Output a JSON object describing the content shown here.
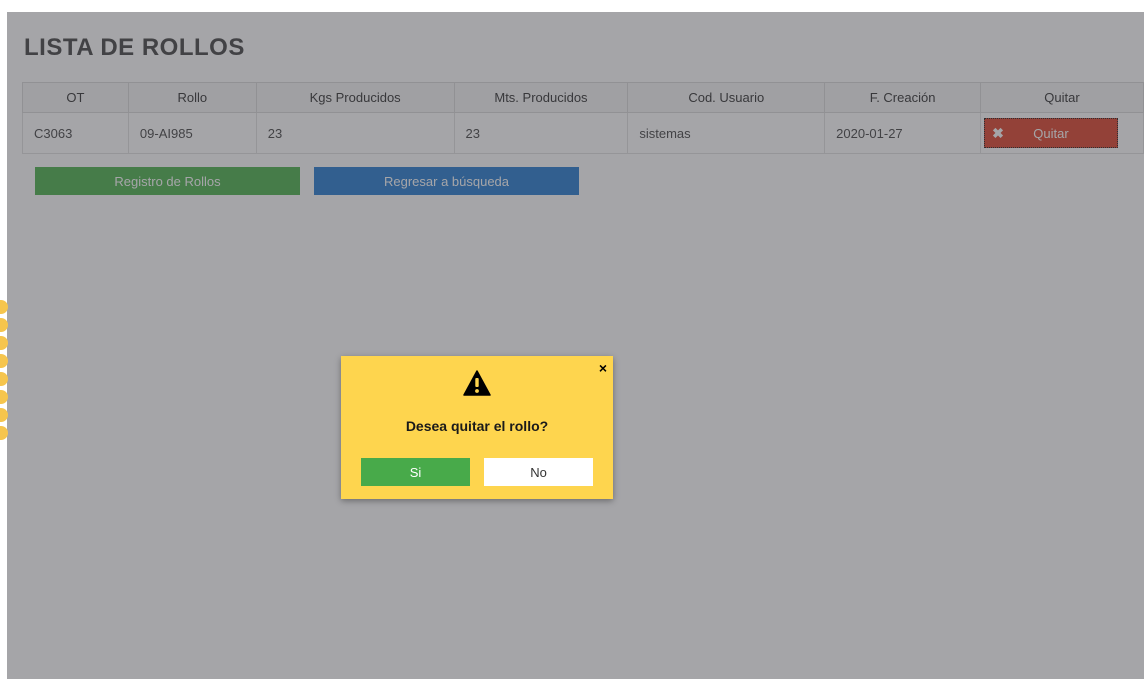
{
  "page": {
    "title": "LISTA DE ROLLOS"
  },
  "table": {
    "headers": [
      "OT",
      "Rollo",
      "Kgs Producidos",
      "Mts. Producidos",
      "Cod. Usuario",
      "F. Creación",
      "Quitar"
    ],
    "rows": [
      {
        "ot": "C3063",
        "rollo": "09-AI985",
        "kgs": "23",
        "mts": "23",
        "usuario": "sistemas",
        "fecha": "2020-01-27",
        "quitar_label": "Quitar",
        "quitar_icon": "close-icon"
      }
    ]
  },
  "buttons": {
    "registro": "Registro de Rollos",
    "regresar": "Regresar a búsqueda"
  },
  "dialog": {
    "message": "Desea quitar el rollo?",
    "yes": "Si",
    "no": "No",
    "icon": "warning-icon",
    "close": "×"
  },
  "colors": {
    "dialog_bg": "#fed54e",
    "success": "#48aa4a",
    "danger": "#e0543e",
    "info": "#3a87d4"
  }
}
